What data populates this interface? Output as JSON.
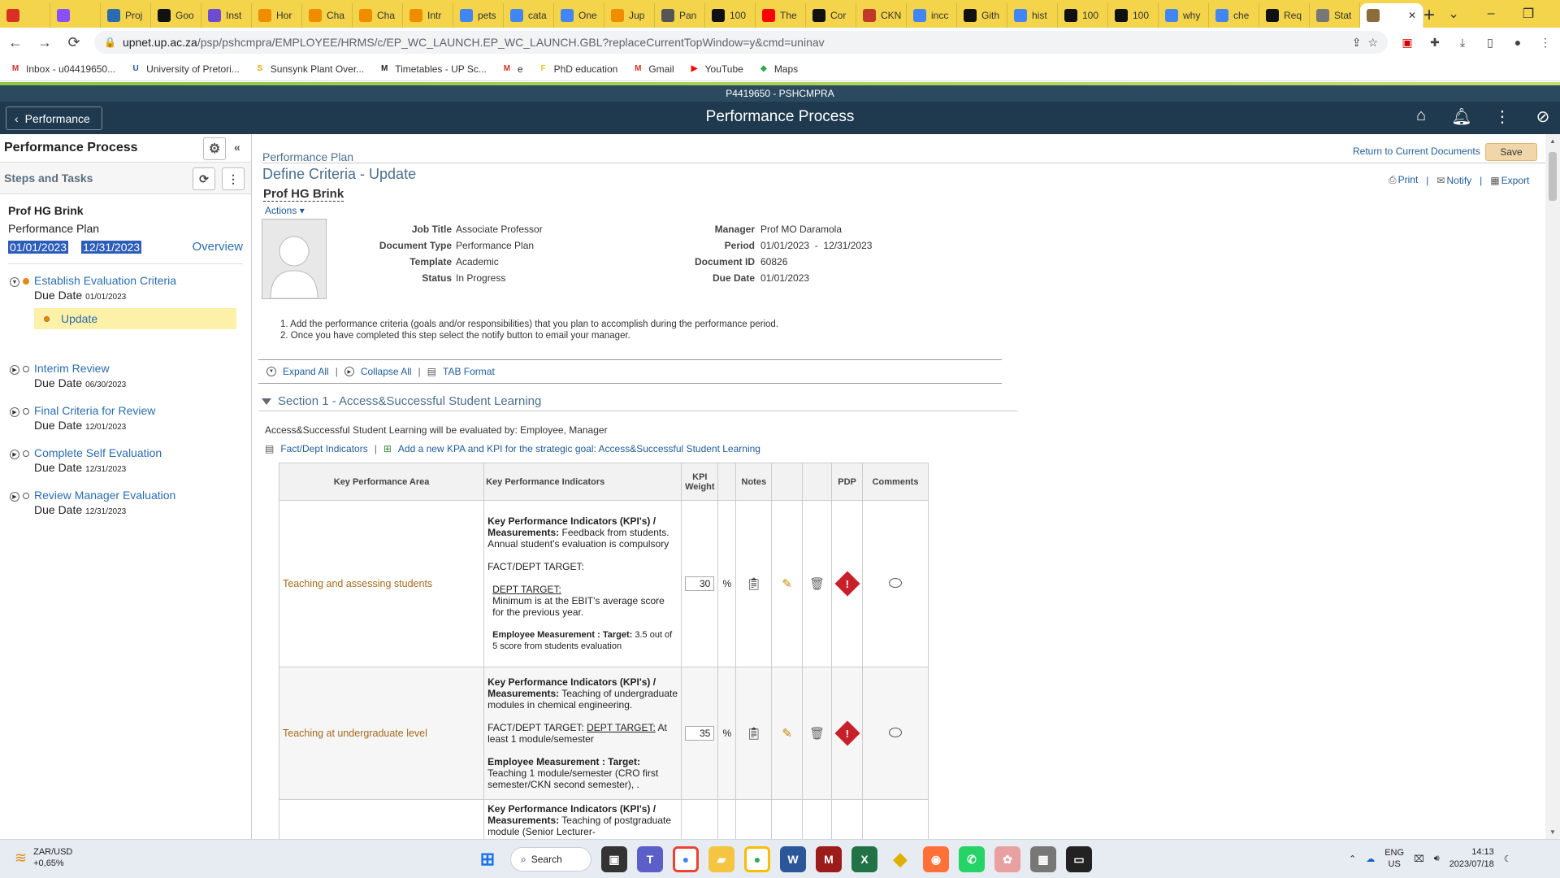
{
  "browser": {
    "tabs": [
      {
        "label": "",
        "icon": "gmail-icon",
        "color": "#d93025"
      },
      {
        "label": "",
        "icon": "pin-icon",
        "color": "#8a4fff"
      },
      {
        "label": "Proj",
        "icon": "bird-icon",
        "color": "#2b6cb0"
      },
      {
        "label": "Goo",
        "icon": "fb-icon",
        "color": "#111"
      },
      {
        "label": "Inst",
        "icon": "inst-icon",
        "color": "#6d4bd3"
      },
      {
        "label": "Hor",
        "icon": "sun-icon",
        "color": "#f08c00"
      },
      {
        "label": "Cha",
        "icon": "chat-icon",
        "color": "#f08c00"
      },
      {
        "label": "Cha",
        "icon": "chat2-icon",
        "color": "#f08c00"
      },
      {
        "label": "Intr",
        "icon": "book-icon",
        "color": "#f08c00"
      },
      {
        "label": "pets",
        "icon": "g-icon",
        "color": "#4285f4"
      },
      {
        "label": "cata",
        "icon": "g-icon",
        "color": "#4285f4"
      },
      {
        "label": "One",
        "icon": "g-icon",
        "color": "#4285f4"
      },
      {
        "label": "Jup",
        "icon": "jup-icon",
        "color": "#f08c00"
      },
      {
        "label": "Pan",
        "icon": "pan-icon",
        "color": "#555"
      },
      {
        "label": "100",
        "icon": "y-icon",
        "color": "#111"
      },
      {
        "label": "The",
        "icon": "yt-icon",
        "color": "#ff0000"
      },
      {
        "label": "Cor",
        "icon": "bar-icon",
        "color": "#111"
      },
      {
        "label": "CKN",
        "icon": "p-icon",
        "color": "#c0392b"
      },
      {
        "label": "incc",
        "icon": "g-icon",
        "color": "#4285f4"
      },
      {
        "label": "Gith",
        "icon": "gh-icon",
        "color": "#111"
      },
      {
        "label": "hist",
        "icon": "g-icon",
        "color": "#4285f4"
      },
      {
        "label": "100",
        "icon": "y-icon",
        "color": "#111"
      },
      {
        "label": "100",
        "icon": "y-icon",
        "color": "#111"
      },
      {
        "label": "why",
        "icon": "g-icon",
        "color": "#4285f4"
      },
      {
        "label": "che",
        "icon": "g-icon",
        "color": "#4285f4"
      },
      {
        "label": "Req",
        "icon": "gh-icon",
        "color": "#111"
      },
      {
        "label": "Stat",
        "icon": "stat-icon",
        "color": "#777"
      },
      {
        "label": "",
        "icon": "up-icon",
        "color": "#8a6d3b",
        "active": true
      }
    ],
    "url_host": "upnet.up.ac.za",
    "url_path": "/psp/pshcmpra/EMPLOYEE/HRMS/c/EP_WC_LAUNCH.EP_WC_LAUNCH.GBL?replaceCurrentTopWindow=y&cmd=uninav",
    "bookmarks": [
      {
        "label": "Inbox - u04419650...",
        "icon": "M",
        "color": "#d93025"
      },
      {
        "label": "University of Pretori...",
        "icon": "U",
        "color": "#1a5a9e"
      },
      {
        "label": "Sunsynk Plant Over...",
        "icon": "S",
        "color": "#e0a800"
      },
      {
        "label": "Timetables - UP Sc...",
        "icon": "M",
        "color": "#222"
      },
      {
        "label": "e",
        "icon": "M",
        "color": "#d93025"
      },
      {
        "label": "PhD education",
        "icon": "F",
        "color": "#e8c040"
      },
      {
        "label": "Gmail",
        "icon": "M",
        "color": "#d93025"
      },
      {
        "label": "YouTube",
        "icon": "▶",
        "color": "#ff0000"
      },
      {
        "label": "Maps",
        "icon": "◆",
        "color": "#34a853"
      }
    ]
  },
  "ps_header": {
    "system_id": "P4419650 - PSHCMPRA",
    "back_label": "Performance",
    "title": "Performance Process"
  },
  "left_panel": {
    "title": "Performance Process",
    "steps_title": "Steps and Tasks",
    "employee": "Prof HG Brink",
    "plan": "Performance Plan",
    "date_from": "01/01/2023",
    "date_to": "12/31/2023",
    "overview": "Overview",
    "due_label": "Due Date",
    "task_label": "Update",
    "steps": [
      {
        "title": "Establish Evaluation Criteria",
        "due": "01/01/2023"
      },
      {
        "title": "Interim Review",
        "due": "06/30/2023"
      },
      {
        "title": "Final Criteria for Review",
        "due": "12/01/2023"
      },
      {
        "title": "Complete Self Evaluation",
        "due": "12/31/2023"
      },
      {
        "title": "Review Manager Evaluation",
        "due": "12/31/2023"
      }
    ]
  },
  "main": {
    "breadcrumb": "Performance Plan",
    "return_link": "Return to Current Documents",
    "save": "Save",
    "print": "Print",
    "notify": "Notify",
    "export": "Export",
    "doc_title": "Define Criteria - Update",
    "person": "Prof HG Brink",
    "actions": "Actions",
    "fields": {
      "job_title_k": "Job Title",
      "job_title_v": "Associate Professor",
      "doc_type_k": "Document Type",
      "doc_type_v": "Performance Plan",
      "template_k": "Template",
      "template_v": "Academic",
      "status_k": "Status",
      "status_v": "In Progress",
      "manager_k": "Manager",
      "manager_v": "Prof MO Daramola",
      "period_k": "Period",
      "period_v": "01/01/2023  -  12/31/2023",
      "docid_k": "Document ID",
      "docid_v": "60826",
      "due_k": "Due Date",
      "due_v": "01/01/2023"
    },
    "instructions": [
      "1. Add the performance criteria (goals and/or responsibilities) that you plan to accomplish during the performance period.",
      "2. Once you have completed this step select the notify button to email your manager."
    ],
    "expand_all": "Expand All",
    "collapse_all": "Collapse All",
    "tab_format": "TAB Format",
    "section_title": "Section 1 - Access&Successful Student Learning",
    "evaluated_by": "Access&Successful Student Learning will be evaluated by: Employee, Manager",
    "fact_dept": "Fact/Dept Indicators",
    "add_kpa": "Add a new KPA and KPI for the strategic goal: Access&Successful Student Learning",
    "table": {
      "headers": [
        "Key Performance Area",
        "Key Performance Indicators",
        "KPI Weight",
        "",
        "Notes",
        "",
        "",
        "PDP",
        "Comments"
      ],
      "percent": "%",
      "rows": [
        {
          "kpa": "Teaching and assessing students",
          "kpi_h": "Key Performance Indicators (KPI's) / Measurements:",
          "kpi_m": "Feedback from students. Annual student's evaluation is compulsory",
          "fact": "FACT/DEPT TARGET:",
          "dept_l": "DEPT TARGET:",
          "dept_v": "Minimum is at the EBIT's average score for the previous year.",
          "emp_l": "Employee Measurement : Target:",
          "emp_v": "3.5 out of 5 score from students evaluation",
          "weight": "30"
        },
        {
          "kpa": "Teaching at undergraduate level",
          "kpi_h": "Key Performance Indicators (KPI's) / Measurements:",
          "kpi_m": "Teaching of undergraduate modules in chemical engineering.",
          "fact": "FACT/DEPT TARGET:",
          "dept_l": "DEPT TARGET:",
          "dept_v": "At least 1 module/semester",
          "emp_l": "Employee Measurement : Target:",
          "emp_v": "Teaching 1 module/semester (CRO first semester/CKN second semester), .",
          "weight": "35"
        },
        {
          "kpa": "",
          "kpi_h": "Key Performance Indicators (KPI's) / Measurements:",
          "kpi_m": "Teaching of postgraduate module (Senior Lecturer-",
          "weight": ""
        }
      ]
    }
  },
  "taskbar": {
    "ticker": "ZAR/USD",
    "change": "+0,65%",
    "search": "Search",
    "lang1": "ENG",
    "lang2": "US",
    "time": "14:13",
    "date": "2023/07/18"
  }
}
